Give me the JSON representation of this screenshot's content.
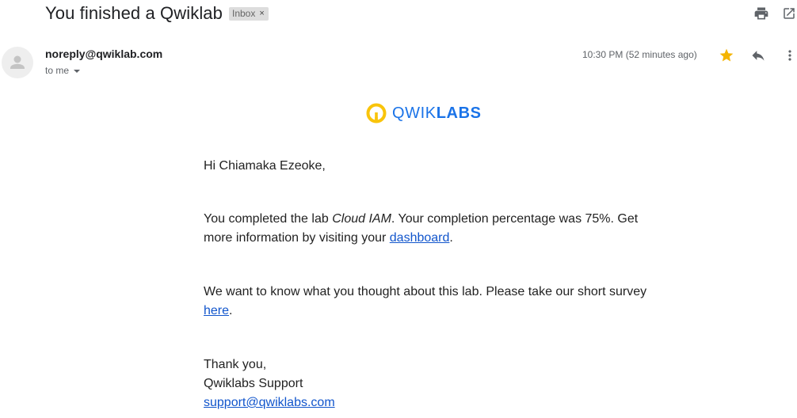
{
  "email": {
    "subject": "You finished a Qwiklab",
    "label": "Inbox",
    "label_remove": "×",
    "sender": "noreply@qwiklab.com",
    "recipient": "to me",
    "timestamp": "10:30 PM (52 minutes ago)",
    "starred": true
  },
  "icons": {
    "print": "print-icon",
    "open_new_window": "open-in-new-window-icon",
    "star": "star-icon",
    "reply": "reply-icon",
    "more": "more-vert-icon",
    "avatar": "person-icon",
    "logo": "qwiklabs-logo-icon"
  },
  "colors": {
    "star": "#f4b400",
    "link": "#1155cc",
    "logo_text": "#1a73e8",
    "logo_ring": "#f9c40b"
  },
  "logo": {
    "text_light": "QWIK",
    "text_bold": "LABS"
  },
  "message": {
    "greeting": "Hi Chiamaka Ezeoke,",
    "completed_prefix": "You completed the lab ",
    "lab_name": "Cloud IAM",
    "completed_middle": ". Your completion percentage was 75%. Get more information by visiting your ",
    "dashboard_link": "dashboard",
    "completed_suffix": ".",
    "survey_prefix": "We want to know what you thought about this lab. Please take our short survey ",
    "survey_link": "here",
    "survey_suffix": ".",
    "thanks": "Thank you,",
    "signature": "Qwiklabs Support",
    "support_email": "support@qwiklabs.com"
  }
}
